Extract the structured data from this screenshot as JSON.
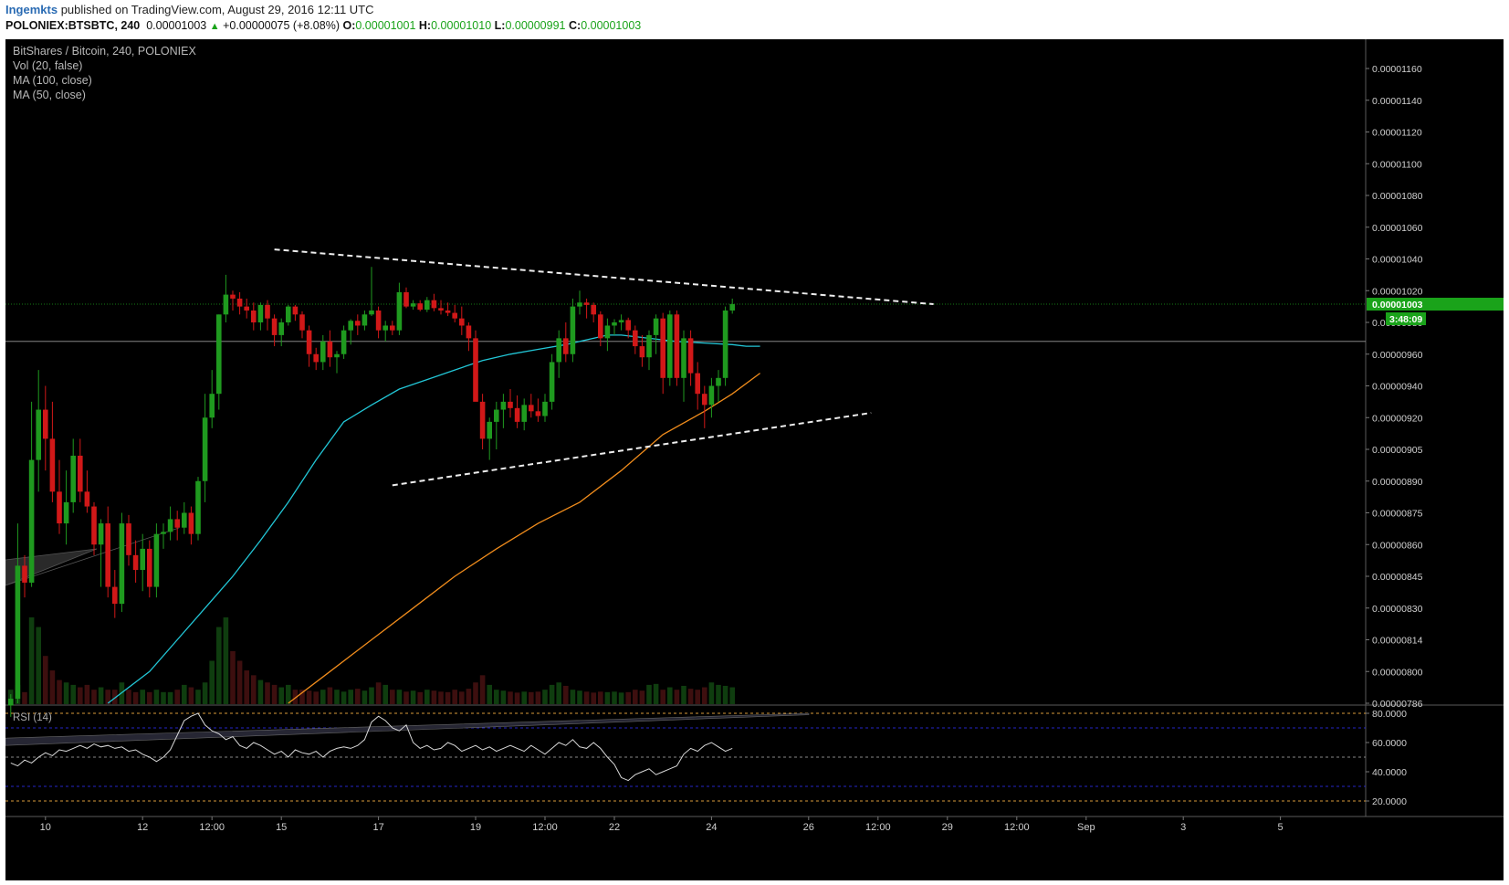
{
  "header": {
    "author": "Ingemkts",
    "published_text": "published on TradingView.com, August 29, 2016 12:11 UTC",
    "symbol": "POLONIEX:BTSBTC, 240",
    "last": "0.00001003",
    "change_arrow": "▲",
    "change": "+0.00000075 (+8.08%)",
    "open_label": "O:",
    "open": "0.00001001",
    "high_label": "H:",
    "high": "0.00001010",
    "low_label": "L:",
    "low": "0.00000991",
    "close_label": "C:",
    "close": "0.00001003"
  },
  "legend": {
    "title": "BitShares / Bitcoin, 240, POLONIEX",
    "vol": "Vol (20, false)",
    "ma100": "MA (100, close)",
    "ma50": "MA (50, close)",
    "rsi": "RSI (14)"
  },
  "colors": {
    "background": "#000000",
    "up_candle": "#1f9a1f",
    "down_candle": "#d11818",
    "ma50": "#22c6d6",
    "ma100": "#f08c1c",
    "trendline": "#eeeeee",
    "price_tag": "#1aa31a",
    "rsi_line": "#d9d9d9",
    "rsi_band": "#2626c8",
    "rsi_extreme": "#d79a3a"
  },
  "chart_data": [
    {
      "type": "candlestick",
      "title": "BitShares / Bitcoin, 240, POLONIEX",
      "price_axis_labels": [
        "0.00001160",
        "0.00001140",
        "0.00001120",
        "0.00001100",
        "0.00001080",
        "0.00001060",
        "0.00001040",
        "0.00001020",
        "0.00000980",
        "0.00000960",
        "0.00000940",
        "0.00000920",
        "0.00000905",
        "0.00000890",
        "0.00000875",
        "0.00000860",
        "0.00000845",
        "0.00000830",
        "0.00000814",
        "0.00000800",
        "0.00000786"
      ],
      "price_axis_values": [
        1160,
        1140,
        1120,
        1100,
        1080,
        1060,
        1040,
        1020,
        980,
        960,
        940,
        920,
        905,
        890,
        875,
        860,
        845,
        830,
        814,
        800,
        786
      ],
      "price_unit_note": "values in 1e-8 BTC",
      "current_price_label": "0.00001003",
      "countdown_label": "3:48:09",
      "x_axis_labels": [
        "10",
        "12",
        "12:00",
        "15",
        "17",
        "19",
        "12:00",
        "22",
        "24",
        "26",
        "12:00",
        "29",
        "12:00",
        "Sep",
        "3",
        "5"
      ],
      "x_axis_slots": [
        5,
        19,
        29,
        39,
        53,
        67,
        77,
        87,
        101,
        115,
        125,
        135,
        145,
        155,
        169,
        183
      ],
      "ohlc": [
        [
          785,
          790,
          780,
          788
        ],
        [
          788,
          870,
          786,
          850
        ],
        [
          850,
          855,
          835,
          842
        ],
        [
          842,
          930,
          840,
          900
        ],
        [
          900,
          950,
          885,
          925
        ],
        [
          925,
          940,
          895,
          910
        ],
        [
          910,
          930,
          880,
          885
        ],
        [
          885,
          900,
          865,
          870
        ],
        [
          870,
          895,
          860,
          880
        ],
        [
          880,
          910,
          875,
          902
        ],
        [
          902,
          910,
          880,
          885
        ],
        [
          885,
          895,
          875,
          878
        ],
        [
          878,
          880,
          855,
          860
        ],
        [
          860,
          872,
          840,
          870
        ],
        [
          870,
          878,
          835,
          840
        ],
        [
          840,
          848,
          825,
          832
        ],
        [
          832,
          875,
          828,
          870
        ],
        [
          870,
          874,
          850,
          855
        ],
        [
          855,
          862,
          842,
          848
        ],
        [
          848,
          865,
          838,
          858
        ],
        [
          858,
          862,
          835,
          840
        ],
        [
          840,
          870,
          835,
          865
        ],
        [
          865,
          870,
          858,
          866
        ],
        [
          866,
          878,
          862,
          872
        ],
        [
          872,
          876,
          862,
          868
        ],
        [
          868,
          880,
          865,
          875
        ],
        [
          875,
          878,
          860,
          865
        ],
        [
          865,
          892,
          862,
          890
        ],
        [
          890,
          935,
          880,
          920
        ],
        [
          920,
          950,
          915,
          935
        ],
        [
          935,
          990,
          925,
          990
        ],
        [
          990,
          1030,
          980,
          1015
        ],
        [
          1015,
          1020,
          995,
          1010
        ],
        [
          1010,
          1018,
          990,
          1000
        ],
        [
          1000,
          1010,
          985,
          995
        ],
        [
          995,
          1005,
          975,
          980
        ],
        [
          980,
          1005,
          975,
          1002
        ],
        [
          1002,
          1008,
          975,
          985
        ],
        [
          985,
          990,
          965,
          972
        ],
        [
          972,
          985,
          965,
          980
        ],
        [
          980,
          1002,
          978,
          1000
        ],
        [
          1000,
          1002,
          982,
          990
        ],
        [
          990,
          994,
          970,
          975
        ],
        [
          975,
          978,
          952,
          960
        ],
        [
          960,
          964,
          950,
          955
        ],
        [
          955,
          972,
          950,
          968
        ],
        [
          968,
          975,
          952,
          958
        ],
        [
          958,
          962,
          948,
          960
        ],
        [
          960,
          978,
          957,
          975
        ],
        [
          975,
          984,
          966,
          982
        ],
        [
          982,
          990,
          972,
          978
        ],
        [
          978,
          995,
          975,
          990
        ],
        [
          990,
          1035,
          988,
          995
        ],
        [
          995,
          1000,
          970,
          975
        ],
        [
          975,
          982,
          968,
          978
        ],
        [
          978,
          982,
          972,
          975
        ],
        [
          975,
          1025,
          972,
          1018
        ],
        [
          1018,
          1022,
          998,
          1000
        ],
        [
          1000,
          1008,
          996,
          1004
        ],
        [
          1004,
          1008,
          994,
          996
        ],
        [
          996,
          1012,
          993,
          1008
        ],
        [
          1008,
          1016,
          994,
          998
        ],
        [
          998,
          1008,
          990,
          995
        ],
        [
          995,
          1005,
          988,
          992
        ],
        [
          992,
          1002,
          980,
          985
        ],
        [
          985,
          1000,
          972,
          978
        ],
        [
          978,
          980,
          962,
          970
        ],
        [
          970,
          975,
          940,
          930
        ],
        [
          930,
          935,
          905,
          910
        ],
        [
          910,
          920,
          900,
          918
        ],
        [
          918,
          930,
          905,
          925
        ],
        [
          925,
          935,
          915,
          930
        ],
        [
          930,
          938,
          920,
          926
        ],
        [
          926,
          934,
          915,
          918
        ],
        [
          918,
          932,
          914,
          928
        ],
        [
          928,
          935,
          920,
          924
        ],
        [
          924,
          932,
          918,
          921
        ],
        [
          921,
          935,
          918,
          930
        ],
        [
          930,
          960,
          925,
          955
        ],
        [
          955,
          975,
          945,
          970
        ],
        [
          970,
          980,
          955,
          960
        ],
        [
          960,
          1010,
          955,
          1000
        ],
        [
          1000,
          1020,
          990,
          1005
        ],
        [
          1005,
          1010,
          985,
          1002
        ],
        [
          1002,
          1005,
          980,
          990
        ],
        [
          990,
          994,
          965,
          970
        ],
        [
          970,
          985,
          962,
          978
        ],
        [
          978,
          984,
          972,
          980
        ],
        [
          980,
          990,
          975,
          983
        ],
        [
          983,
          986,
          970,
          975
        ],
        [
          975,
          978,
          960,
          965
        ],
        [
          965,
          972,
          952,
          958
        ],
        [
          958,
          975,
          950,
          972
        ],
        [
          972,
          990,
          960,
          985
        ],
        [
          985,
          992,
          935,
          945
        ],
        [
          945,
          995,
          940,
          990
        ],
        [
          990,
          995,
          940,
          945
        ],
        [
          945,
          975,
          930,
          970
        ],
        [
          970,
          975,
          940,
          948
        ],
        [
          948,
          955,
          925,
          935
        ],
        [
          935,
          940,
          915,
          928
        ],
        [
          928,
          945,
          920,
          940
        ],
        [
          940,
          950,
          930,
          945
        ],
        [
          945,
          1000,
          940,
          995
        ],
        [
          995,
          1010,
          991,
          1003
        ]
      ],
      "volume": [
        30,
        40,
        25,
        180,
        160,
        100,
        70,
        50,
        45,
        40,
        35,
        40,
        30,
        35,
        30,
        30,
        45,
        30,
        25,
        30,
        25,
        30,
        25,
        25,
        30,
        40,
        35,
        30,
        45,
        90,
        160,
        180,
        110,
        90,
        70,
        60,
        50,
        45,
        40,
        35,
        40,
        30,
        30,
        28,
        26,
        30,
        35,
        30,
        26,
        30,
        32,
        28,
        35,
        45,
        40,
        30,
        30,
        26,
        28,
        25,
        30,
        28,
        26,
        25,
        30,
        26,
        32,
        45,
        60,
        40,
        30,
        28,
        26,
        24,
        26,
        25,
        26,
        30,
        40,
        45,
        38,
        30,
        28,
        26,
        24,
        26,
        25,
        26,
        24,
        25,
        30,
        28,
        40,
        42,
        30,
        35,
        30,
        38,
        32,
        30,
        35,
        45,
        40,
        38,
        35
      ],
      "ma50": [
        null,
        null,
        null,
        null,
        null,
        null,
        null,
        null,
        null,
        null,
        null,
        null,
        null,
        null,
        null,
        null,
        null,
        null,
        null,
        null,
        null,
        null,
        null,
        null,
        null,
        null,
        null,
        null,
        null,
        null,
        null,
        null,
        null,
        null,
        null,
        null,
        null,
        null,
        null,
        null,
        null,
        null,
        null,
        null,
        null,
        null,
        null,
        null,
        null,
        null,
        null,
        null,
        null,
        null,
        null,
        null,
        null,
        null,
        null,
        null,
        null,
        null,
        null,
        null,
        null,
        null,
        null,
        null,
        null,
        null,
        null,
        null,
        null,
        null,
        null,
        null,
        null,
        null,
        null,
        null,
        null,
        null,
        null,
        null,
        null,
        null,
        null,
        null,
        null,
        null,
        null,
        null,
        null,
        null,
        null,
        null,
        null,
        null,
        null,
        null,
        null,
        null,
        null,
        null,
        null
      ],
      "ma50_path": [
        [
          14,
          786
        ],
        [
          20,
          800
        ],
        [
          24,
          814
        ],
        [
          28,
          830
        ],
        [
          32,
          845
        ],
        [
          36,
          862
        ],
        [
          40,
          880
        ],
        [
          44,
          900
        ],
        [
          48,
          918
        ],
        [
          52,
          928
        ],
        [
          56,
          938
        ],
        [
          60,
          944
        ],
        [
          64,
          950
        ],
        [
          68,
          956
        ],
        [
          72,
          960
        ],
        [
          76,
          963
        ],
        [
          80,
          966
        ],
        [
          84,
          970
        ],
        [
          86,
          972
        ],
        [
          88,
          972
        ],
        [
          92,
          970
        ],
        [
          96,
          968
        ],
        [
          100,
          967
        ],
        [
          104,
          966
        ],
        [
          106,
          965
        ],
        [
          108,
          965
        ]
      ],
      "ma100_path": [
        [
          40,
          786
        ],
        [
          46,
          800
        ],
        [
          52,
          814
        ],
        [
          58,
          830
        ],
        [
          64,
          845
        ],
        [
          70,
          858
        ],
        [
          76,
          870
        ],
        [
          82,
          880
        ],
        [
          88,
          895
        ],
        [
          94,
          912
        ],
        [
          100,
          924
        ],
        [
          104,
          935
        ],
        [
          108,
          948
        ]
      ],
      "trendlines": [
        {
          "from": [
            38,
            1046
          ],
          "to": [
            133,
            1003
          ]
        },
        {
          "from": [
            55,
            888
          ],
          "to": [
            124,
            923
          ]
        }
      ],
      "horizontal_line": 968,
      "last_price_line": 1003
    },
    {
      "type": "line",
      "title": "RSI (14)",
      "y_axis_labels": [
        "80.0000",
        "60.0000",
        "40.0000",
        "20.0000"
      ],
      "y_axis_values": [
        80,
        60,
        40,
        20
      ],
      "levels": {
        "overbought": 70,
        "oversold": 30,
        "extreme_high": 80,
        "extreme_low": 20,
        "mid": 50
      },
      "values": [
        46,
        44,
        48,
        46,
        50,
        53,
        51,
        55,
        54,
        56,
        58,
        56,
        59,
        57,
        58,
        56,
        57,
        54,
        55,
        52,
        50,
        47,
        50,
        55,
        65,
        75,
        78,
        80,
        72,
        68,
        66,
        62,
        64,
        58,
        56,
        60,
        58,
        55,
        52,
        54,
        50,
        55,
        53,
        52,
        54,
        50,
        54,
        56,
        57,
        56,
        58,
        62,
        74,
        78,
        75,
        70,
        68,
        72,
        60,
        56,
        58,
        55,
        56,
        60,
        58,
        54,
        56,
        58,
        55,
        57,
        54,
        56,
        58,
        56,
        54,
        58,
        55,
        52,
        56,
        60,
        58,
        62,
        57,
        56,
        60,
        56,
        50,
        45,
        36,
        34,
        38,
        40,
        42,
        38,
        40,
        42,
        44,
        52,
        56,
        54,
        58,
        60,
        57,
        54,
        56
      ]
    }
  ]
}
